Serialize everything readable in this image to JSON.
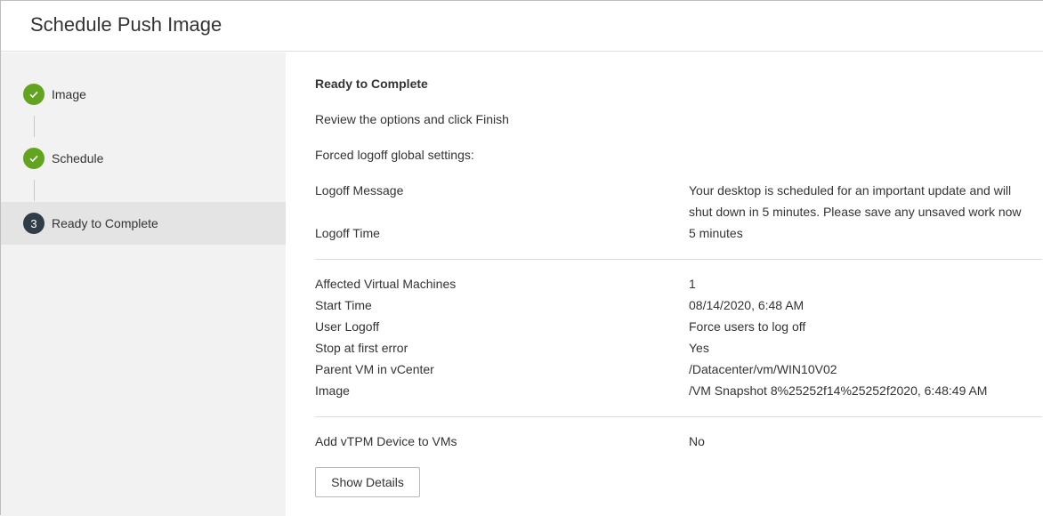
{
  "dialog": {
    "title": "Schedule Push Image"
  },
  "steps": [
    {
      "label": "Image",
      "state": "done"
    },
    {
      "label": "Schedule",
      "state": "done"
    },
    {
      "label": "Ready to Complete",
      "state": "current",
      "number": "3"
    }
  ],
  "content": {
    "heading": "Ready to Complete",
    "instruction": "Review the options and click Finish",
    "forced_logoff_title": "Forced logoff global settings:",
    "logoff_message_label": "Logoff Message",
    "logoff_message_line1": "Your desktop is scheduled for an important update and will",
    "logoff_message_line2": "shut down in 5 minutes. Please save any unsaved work now",
    "logoff_time_label": "Logoff Time",
    "logoff_time_value": "5 minutes",
    "details": [
      {
        "label": "Affected Virtual Machines",
        "value": "1"
      },
      {
        "label": "Start Time",
        "value": "08/14/2020, 6:48 AM"
      },
      {
        "label": "User Logoff",
        "value": "Force users to log off"
      },
      {
        "label": "Stop at first error",
        "value": "Yes"
      },
      {
        "label": "Parent VM in vCenter",
        "value": "/Datacenter/vm/WIN10V02"
      },
      {
        "label": "Image",
        "value": "/VM Snapshot 8%25252f14%25252f2020, 6:48:49 AM"
      }
    ],
    "vtpm_label": "Add vTPM Device to VMs",
    "vtpm_value": "No",
    "show_details_button": "Show Details"
  },
  "colors": {
    "done": "#62a420",
    "current": "#313c49",
    "sidebar_bg": "#f2f2f2",
    "active_step_bg": "#e4e4e4"
  },
  "icons": {
    "done_step": "check-icon"
  }
}
